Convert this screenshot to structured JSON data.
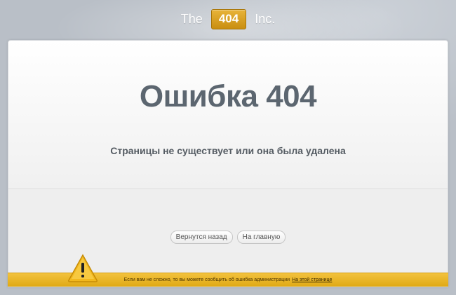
{
  "brand": {
    "left_word": "The",
    "badge": "404",
    "right_word": "Inc."
  },
  "error": {
    "title": "Ошибка 404",
    "message": "Страницы не существует или она была удалена"
  },
  "actions": {
    "back_label": "Вернутся назад",
    "home_label": "На главную"
  },
  "footer": {
    "notice": "Если вам не сложно, то вы можете сообщить об ошибка администрации",
    "link_label": "На этой странице"
  },
  "colors": {
    "accent": "#e5ad1c",
    "title": "#5c6670",
    "background": "#b9bfc7"
  },
  "icons": {
    "warning": "warning-icon"
  }
}
